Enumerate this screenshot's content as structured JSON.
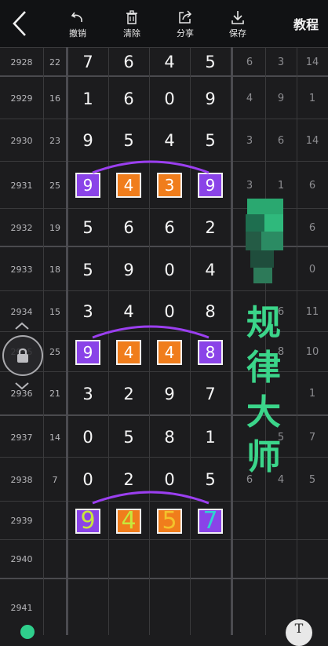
{
  "toolbar": {
    "undo_label": "撤销",
    "clear_label": "清除",
    "share_label": "分享",
    "save_label": "保存",
    "tutorial_label": "教程"
  },
  "rows": [
    {
      "issue": "2928",
      "sum": "22",
      "digits": [
        "7",
        "6",
        "4",
        "5"
      ],
      "side": [
        "6",
        "3",
        "14"
      ]
    },
    {
      "issue": "2929",
      "sum": "16",
      "digits": [
        "1",
        "6",
        "0",
        "9"
      ],
      "side": [
        "4",
        "9",
        "1"
      ]
    },
    {
      "issue": "2930",
      "sum": "23",
      "digits": [
        "9",
        "5",
        "4",
        "5"
      ],
      "side": [
        "3",
        "6",
        "14"
      ]
    },
    {
      "issue": "2931",
      "sum": "25",
      "digits": [
        "9",
        "4",
        "3",
        "9"
      ],
      "side": [
        "3",
        "1",
        "6"
      ]
    },
    {
      "issue": "2932",
      "sum": "19",
      "digits": [
        "5",
        "6",
        "6",
        "2"
      ],
      "side": [
        "",
        "",
        "6"
      ]
    },
    {
      "issue": "2933",
      "sum": "18",
      "digits": [
        "5",
        "9",
        "0",
        "4"
      ],
      "side": [
        "",
        "",
        "0"
      ]
    },
    {
      "issue": "2934",
      "sum": "15",
      "digits": [
        "3",
        "4",
        "0",
        "8"
      ],
      "side": [
        "",
        "6",
        "11"
      ]
    },
    {
      "issue": "2935",
      "sum": "25",
      "digits": [
        "9",
        "4",
        "4",
        "8"
      ],
      "side": [
        "",
        "8",
        "10"
      ]
    },
    {
      "issue": "2936",
      "sum": "21",
      "digits": [
        "3",
        "2",
        "9",
        "7"
      ],
      "side": [
        "",
        "",
        "1"
      ]
    },
    {
      "issue": "2937",
      "sum": "14",
      "digits": [
        "0",
        "5",
        "8",
        "1"
      ],
      "side": [
        "",
        "5",
        "7"
      ]
    },
    {
      "issue": "2938",
      "sum": "7",
      "digits": [
        "0",
        "2",
        "0",
        "5"
      ],
      "side": [
        "6",
        "4",
        "5"
      ]
    },
    {
      "issue": "2939",
      "sum": "",
      "digits": [
        "9",
        "4",
        "5",
        "7"
      ],
      "side": [
        "",
        "",
        ""
      ]
    },
    {
      "issue": "2940",
      "sum": "",
      "digits": [
        "",
        "",
        "",
        ""
      ],
      "side": [
        "",
        "",
        ""
      ]
    },
    {
      "issue": "2941",
      "sum": "",
      "digits": [
        "",
        "",
        "",
        ""
      ],
      "side": [
        "",
        "",
        ""
      ]
    }
  ],
  "prediction_colors": [
    "#c7e83c",
    "#c7e83c",
    "#f3c22b",
    "#2fd3d0"
  ],
  "watermark": {
    "line1": "规",
    "line2": "律",
    "line3": "大",
    "line4": "师"
  },
  "floating": {
    "lock_icon": "lock-icon",
    "text_tool_label": "T"
  },
  "colors": {
    "purple": "#8a43e8",
    "orange": "#f07d1c",
    "arc": "#9b3ff0",
    "watermark": "#3bd58a"
  }
}
